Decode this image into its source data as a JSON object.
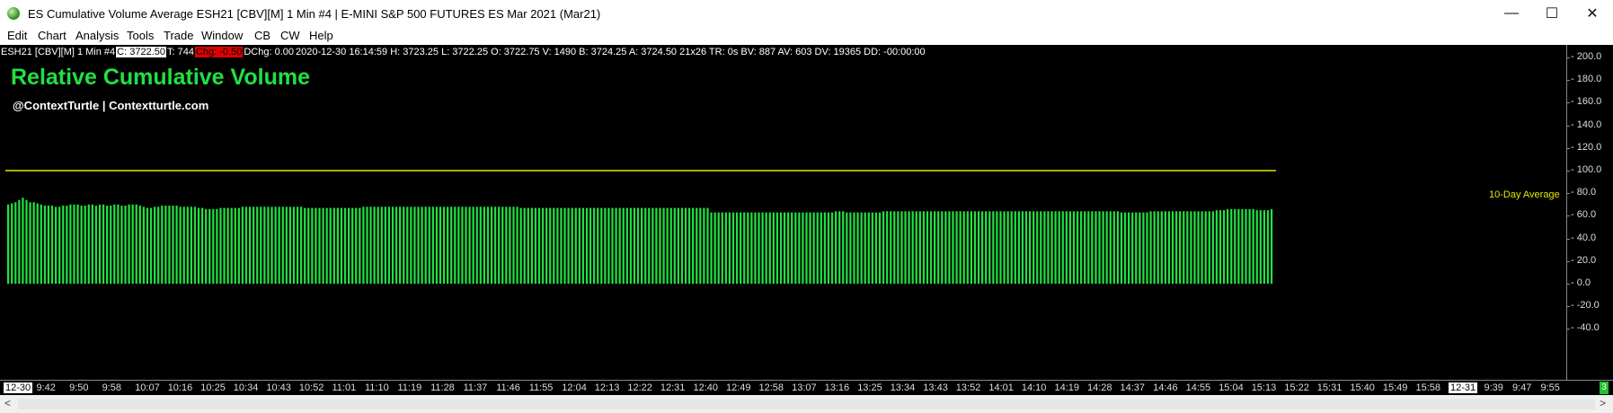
{
  "window": {
    "title": "ES Cumulative Volume Average ESH21 [CBV][M]  1 Min   #4 | E-MINI S&P 500 FUTURES ES Mar 2021 (Mar21)",
    "minimize": "—",
    "maximize": "☐",
    "close": "✕"
  },
  "menu": [
    "Edit",
    "Chart",
    "Analysis",
    "Tools",
    "Trade",
    "Window",
    "CB",
    "CW",
    "Help"
  ],
  "infobar": {
    "symbol": "ESH21 [CBV][M]  1 Min   #4",
    "close": "C: 3722.50",
    "ticks": "T: 744",
    "chg": "Chg: -0.50",
    "dchg": "DChg: 0.00",
    "details": "2020-12-30 16:14:59 H: 3723.25 L: 3722.25 O: 3722.75 V: 1490 B: 3724.25 A: 3724.50 21x26 TR: 0s BV: 887 AV: 603 DV: 19365 DD: -00:00:00"
  },
  "chart_title": "Relative Cumulative Volume",
  "chart_subtitle": "@ContextTurtle | Contextturtle.com",
  "colors": {
    "bars": "#22e042",
    "average_line": "#e6e600",
    "background": "#000000"
  },
  "chart_data": {
    "type": "bar",
    "series": [
      {
        "values": [
          70,
          71,
          72,
          74,
          76,
          74,
          72,
          72,
          71,
          70,
          69,
          69,
          69,
          68,
          68,
          69,
          69,
          70,
          70,
          70,
          69,
          69,
          70,
          70,
          69,
          70,
          70,
          69,
          69,
          70,
          70,
          69,
          69,
          70,
          70,
          70,
          69,
          68,
          67,
          67,
          68,
          68,
          69,
          69,
          69,
          69,
          69,
          68,
          68,
          68,
          68,
          68,
          67,
          67,
          66,
          66,
          66,
          66,
          67,
          67,
          67,
          67,
          67,
          67,
          68,
          68,
          68,
          68,
          68,
          68,
          68,
          68,
          68,
          68,
          68,
          68,
          68,
          68,
          68,
          68,
          68,
          67,
          67,
          67,
          67,
          67,
          67,
          67,
          67,
          67,
          67,
          67,
          67,
          67,
          67,
          67,
          67,
          68,
          68,
          68,
          68,
          68,
          68,
          68,
          68,
          68,
          68,
          68,
          68,
          68,
          68,
          68,
          68,
          68,
          68,
          68,
          68,
          68,
          68,
          68,
          68,
          68,
          68,
          68,
          68,
          68,
          68,
          68,
          68,
          68,
          68,
          68,
          68,
          68,
          68,
          68,
          68,
          68,
          68,
          68,
          67,
          67,
          67,
          67,
          67,
          67,
          67,
          67,
          67,
          67,
          67,
          67,
          67,
          67,
          67,
          67,
          67,
          67,
          67,
          67,
          67,
          67,
          67,
          67,
          67,
          67,
          67,
          67,
          67,
          67,
          67,
          67,
          67,
          67,
          67,
          67,
          67,
          67,
          67,
          67,
          67,
          67,
          67,
          67,
          67,
          67,
          67,
          67,
          67,
          67,
          67,
          67,
          63,
          63,
          63,
          63,
          63,
          63,
          63,
          63,
          63,
          63,
          63,
          63,
          63,
          63,
          63,
          63,
          63,
          63,
          63,
          63,
          63,
          63,
          63,
          63,
          63,
          63,
          63,
          63,
          63,
          63,
          63,
          63,
          63,
          63,
          64,
          64,
          64,
          63,
          63,
          63,
          63,
          63,
          63,
          63,
          63,
          63,
          63,
          64,
          64,
          64,
          64,
          64,
          64,
          64,
          64,
          64,
          64,
          64,
          64,
          64,
          64,
          64,
          64,
          64,
          64,
          64,
          64,
          64,
          64,
          64,
          64,
          64,
          64,
          64,
          64,
          64,
          64,
          64,
          64,
          64,
          64,
          64,
          64,
          64,
          64,
          64,
          64,
          64,
          64,
          64,
          64,
          64,
          64,
          64,
          64,
          64,
          64,
          64,
          64,
          64,
          64,
          64,
          64,
          64,
          64,
          64,
          64,
          64,
          64,
          64,
          64,
          64,
          63,
          63,
          63,
          63,
          63,
          63,
          63,
          63,
          64,
          64,
          64,
          64,
          64,
          64,
          64,
          64,
          64,
          64,
          64,
          64,
          64,
          64,
          64,
          64,
          64,
          64,
          65,
          65,
          65,
          66,
          66,
          66,
          66,
          66,
          66,
          66,
          66,
          65,
          65,
          65,
          65,
          66
        ]
      }
    ],
    "reference_line": {
      "value": 100,
      "label": "10-Day Average"
    },
    "ylim": [
      -40,
      210
    ],
    "yticks": [
      "200.0",
      "180.0",
      "160.0",
      "140.0",
      "120.0",
      "100.0",
      "80.0",
      "60.0",
      "40.0",
      "20.0",
      "0.0",
      "-20.0",
      "-40.0"
    ],
    "xticks": [
      "12-30",
      "9:42",
      "9:50",
      "9:58",
      "10:07",
      "10:16",
      "10:25",
      "10:34",
      "10:43",
      "10:52",
      "11:01",
      "11:10",
      "11:19",
      "11:28",
      "11:37",
      "11:46",
      "11:55",
      "12:04",
      "12:13",
      "12:22",
      "12:31",
      "12:40",
      "12:49",
      "12:58",
      "13:07",
      "13:16",
      "13:25",
      "13:34",
      "13:43",
      "13:52",
      "14:01",
      "14:10",
      "14:19",
      "14:28",
      "14:37",
      "14:46",
      "14:55",
      "15:04",
      "15:13",
      "15:22",
      "15:31",
      "15:40",
      "15:49",
      "15:58",
      "12-31",
      "9:39",
      "9:47",
      "9:55"
    ],
    "grid": false
  },
  "status_marker": "3",
  "scroll": {
    "left": "<",
    "right": ">"
  }
}
